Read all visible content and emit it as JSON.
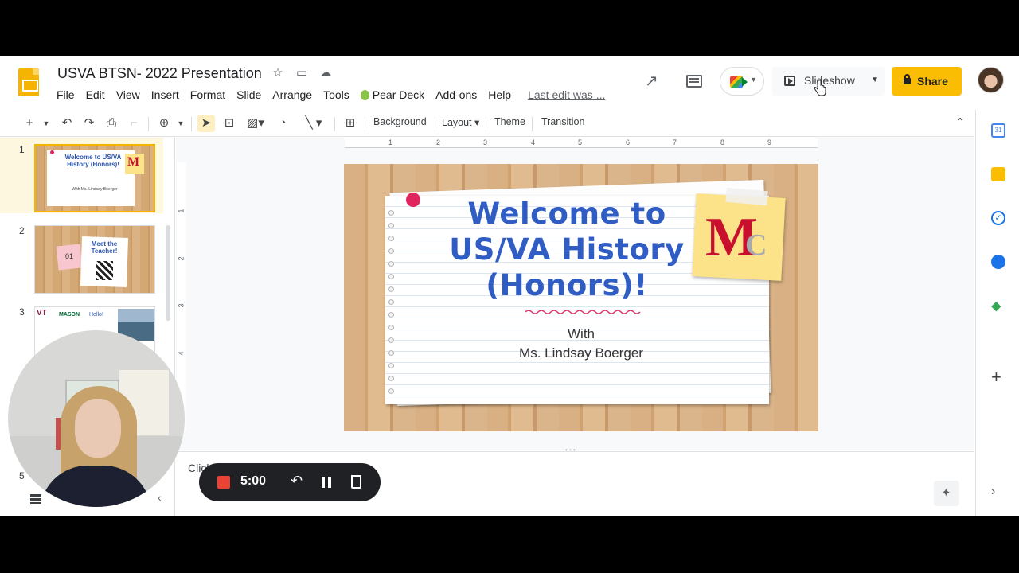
{
  "header": {
    "doc_title": "USVA BTSN- 2022 Presentation",
    "last_edit": "Last edit was ...",
    "slideshow_label": "Slideshow",
    "share_label": "Share"
  },
  "menu": [
    "File",
    "Edit",
    "View",
    "Insert",
    "Format",
    "Slide",
    "Arrange",
    "Tools",
    "Pear Deck",
    "Add-ons",
    "Help"
  ],
  "toolbar": {
    "background_label": "Background",
    "layout_label": "Layout",
    "theme_label": "Theme",
    "transition_label": "Transition"
  },
  "filmstrip": {
    "slides": [
      {
        "number": "1",
        "title": "Welcome to US/VA History (Honors)!",
        "subtitle": "With Ms. Lindsay Boerger"
      },
      {
        "number": "2",
        "title": "Meet the Teacher!",
        "tag": "01"
      },
      {
        "number": "3",
        "title": "Hello!",
        "logo_text": "MASON"
      },
      {
        "number": "5"
      }
    ]
  },
  "ruler": {
    "h_ticks": [
      "1",
      "2",
      "3",
      "4",
      "5",
      "6",
      "7",
      "8",
      "9"
    ],
    "v_ticks": [
      "1",
      "2",
      "3",
      "4"
    ]
  },
  "slide": {
    "title_line1": "Welcome to",
    "title_line2": "US/VA History",
    "title_line3": "(Honors)!",
    "subtitle_line1": "With",
    "subtitle_line2": "Ms. Lindsay Boerger",
    "logo_m": "M",
    "logo_c": "C"
  },
  "notes": {
    "placeholder": "Click to add speaker notes"
  },
  "recorder": {
    "time": "5:00"
  },
  "colors": {
    "accent": "#fbbc04",
    "title_blue": "#2f5dc4",
    "record_red": "#ea4335"
  }
}
